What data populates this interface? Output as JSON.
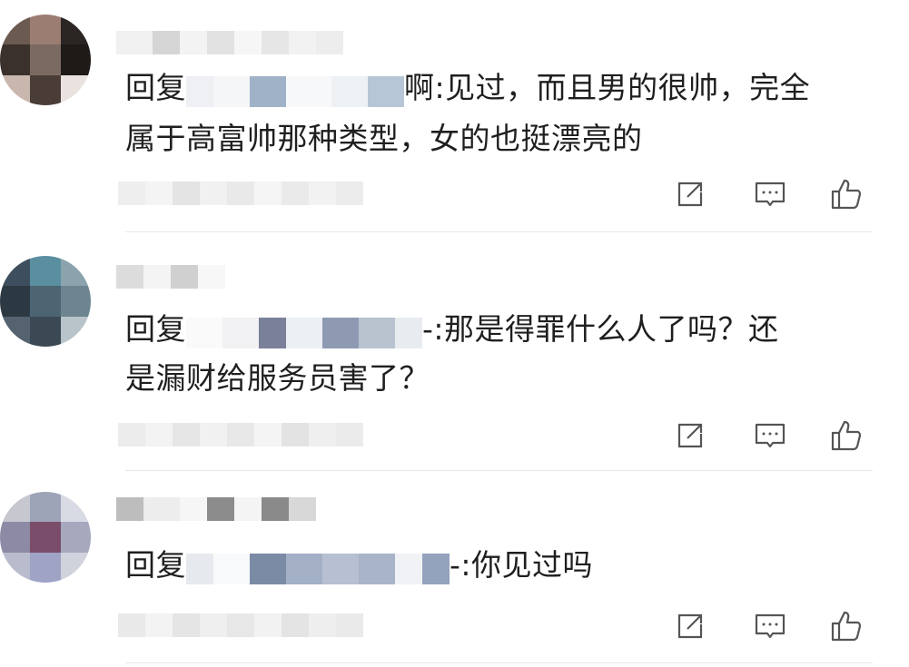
{
  "comments": [
    {
      "reply_prefix": "回复",
      "text_line1": "啊:见过，而且男的很帅，完全",
      "text_line2": "属于高富帅那种类型，女的也挺漂亮的",
      "avatar_colors": [
        "#6b5a50",
        "#9b7d72",
        "#2b2523",
        "#3a302c",
        "#7a6a62",
        "#1e1a18",
        "#c9b7ad",
        "#4a3d38",
        "#e9e2de"
      ]
    },
    {
      "reply_prefix": "回复",
      "text_line1": "-:那是得罪什么人了吗？还",
      "text_line2": "是漏财给服务员害了？",
      "avatar_colors": [
        "#3d4f5e",
        "#5a8fa0",
        "#8aa3ad",
        "#2c3942",
        "#4d6473",
        "#6d8591",
        "#556270",
        "#3a4954",
        "#b8c4ca"
      ]
    },
    {
      "reply_prefix": "回复",
      "text_line1": "-:你见过吗",
      "text_line2": "",
      "avatar_colors": [
        "#c7c7d0",
        "#9ea4b8",
        "#d9dbe4",
        "#8d8aa6",
        "#7a4d6a",
        "#a6a9be",
        "#b9bccc",
        "#9fa3c6",
        "#d0d2dc"
      ]
    }
  ],
  "actions": {
    "share_icon": "share-icon",
    "comment_icon": "comment-icon",
    "like_icon": "thumbs-up-icon"
  }
}
